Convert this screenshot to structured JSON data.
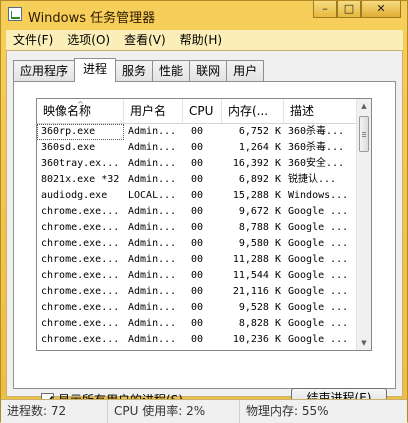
{
  "window": {
    "title": "Windows 任务管理器"
  },
  "window_buttons": {
    "minimize": "–",
    "maximize": "□",
    "close": "✕"
  },
  "menu": [
    "文件(F)",
    "选项(O)",
    "查看(V)",
    "帮助(H)"
  ],
  "tabs": [
    {
      "label": "应用程序",
      "active": false
    },
    {
      "label": "进程",
      "active": true
    },
    {
      "label": "服务",
      "active": false
    },
    {
      "label": "性能",
      "active": false
    },
    {
      "label": "联网",
      "active": false
    },
    {
      "label": "用户",
      "active": false
    }
  ],
  "columns": [
    "映像名称",
    "用户名",
    "CPU",
    "内存(...",
    "描述"
  ],
  "sort_indicator": "^",
  "processes": [
    {
      "name": "360rp.exe",
      "user": "Admin...",
      "cpu": "00",
      "mem": "6,752 K",
      "desc": "360杀毒..."
    },
    {
      "name": "360sd.exe",
      "user": "Admin...",
      "cpu": "00",
      "mem": "1,264 K",
      "desc": "360杀毒..."
    },
    {
      "name": "360tray.ex...",
      "user": "Admin...",
      "cpu": "00",
      "mem": "16,392 K",
      "desc": "360安全..."
    },
    {
      "name": "8021x.exe *32",
      "user": "Admin...",
      "cpu": "00",
      "mem": "6,892 K",
      "desc": "锐捷认..."
    },
    {
      "name": "audiodg.exe",
      "user": "LOCAL...",
      "cpu": "00",
      "mem": "15,288 K",
      "desc": "Windows..."
    },
    {
      "name": "chrome.exe...",
      "user": "Admin...",
      "cpu": "00",
      "mem": "9,672 K",
      "desc": "Google ..."
    },
    {
      "name": "chrome.exe...",
      "user": "Admin...",
      "cpu": "00",
      "mem": "8,788 K",
      "desc": "Google ..."
    },
    {
      "name": "chrome.exe...",
      "user": "Admin...",
      "cpu": "00",
      "mem": "9,580 K",
      "desc": "Google ..."
    },
    {
      "name": "chrome.exe...",
      "user": "Admin...",
      "cpu": "00",
      "mem": "11,288 K",
      "desc": "Google ..."
    },
    {
      "name": "chrome.exe...",
      "user": "Admin...",
      "cpu": "00",
      "mem": "11,544 K",
      "desc": "Google ..."
    },
    {
      "name": "chrome.exe...",
      "user": "Admin...",
      "cpu": "00",
      "mem": "21,116 K",
      "desc": "Google ..."
    },
    {
      "name": "chrome.exe...",
      "user": "Admin...",
      "cpu": "00",
      "mem": "9,528 K",
      "desc": "Google ..."
    },
    {
      "name": "chrome.exe...",
      "user": "Admin...",
      "cpu": "00",
      "mem": "8,828 K",
      "desc": "Google ..."
    },
    {
      "name": "chrome.exe...",
      "user": "Admin...",
      "cpu": "00",
      "mem": "10,236 K",
      "desc": "Google ..."
    }
  ],
  "scroll_arrows": {
    "up": "▲",
    "down": "▼"
  },
  "show_all_label": "显示所有用户的进程(S)",
  "end_process_label": "结束进程(E)",
  "status": {
    "processes": "进程数: 72",
    "cpu": "CPU 使用率: 2%",
    "memory": "物理内存: 55%"
  },
  "colors": {
    "frame": "#f0c64a",
    "menubar": "#fbeeb8",
    "panel": "#f0f0f0"
  }
}
